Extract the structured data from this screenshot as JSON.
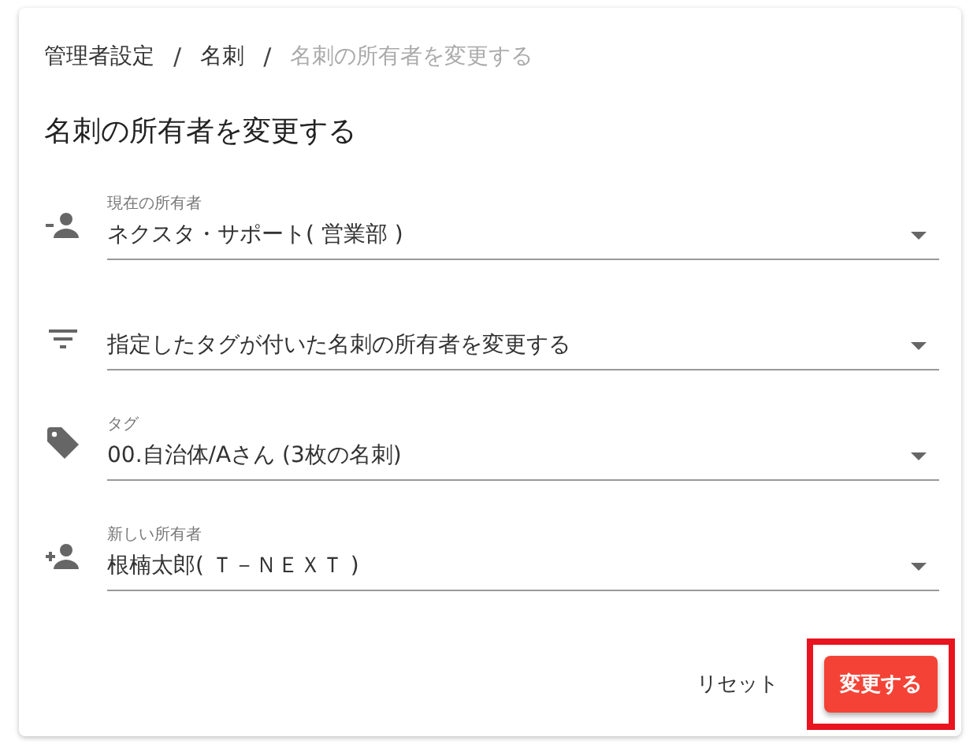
{
  "breadcrumbs": [
    {
      "label": "管理者設定",
      "current": false
    },
    {
      "label": "名刺",
      "current": false
    },
    {
      "label": "名刺の所有者を変更する",
      "current": true
    }
  ],
  "breadcrumb_separators": [
    "/",
    "/"
  ],
  "title": "名刺の所有者を変更する",
  "fields": [
    {
      "kind": "removeperson",
      "label": "現在の所有者",
      "value": "ネクスタ・サポート( 営業部 )"
    },
    {
      "kind": "filter",
      "value": "指定したタグが付いた名刺の所有者を変更する"
    },
    {
      "kind": "tag",
      "label": "タグ",
      "value": "00.自治体/Aさん (3枚の名刺)"
    },
    {
      "kind": "addperson",
      "label": "新しい所有者",
      "value": "根楠太郎( Ｔ－ＮＥＸＴ )"
    }
  ],
  "actions": {
    "reset": "リセット",
    "submit": {
      "label": "変更する",
      "highlighted": true
    }
  }
}
